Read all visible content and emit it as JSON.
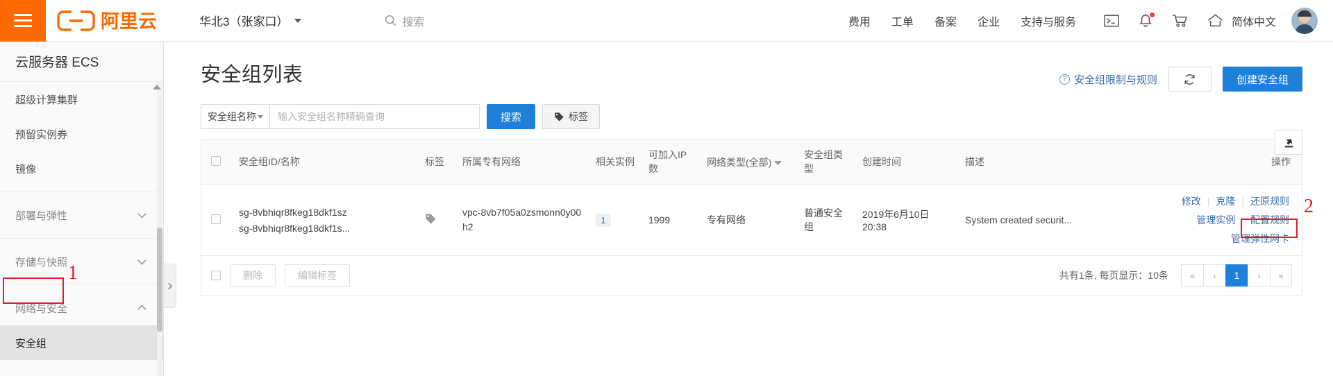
{
  "topbar": {
    "menu_icon": "hamburger-icon",
    "brand_name": "阿里云",
    "region": "华北3（张家口）",
    "search_placeholder": "搜索",
    "nav_links": [
      {
        "label": "费用"
      },
      {
        "label": "工单"
      },
      {
        "label": "备案"
      },
      {
        "label": "企业"
      },
      {
        "label": "支持与服务"
      }
    ],
    "icons": [
      {
        "name": "terminal-icon"
      },
      {
        "name": "bell-icon",
        "badge": true
      },
      {
        "name": "shopping-cart-icon"
      },
      {
        "name": "home-icon"
      }
    ],
    "language": "简体中文",
    "avatar": "user-avatar"
  },
  "sidebar": {
    "title": "云服务器 ECS",
    "items": [
      {
        "label": "超级计算集群",
        "type": "link",
        "active": false
      },
      {
        "label": "预留实例券",
        "type": "link",
        "active": false
      },
      {
        "label": "镜像",
        "type": "link",
        "active": false
      },
      {
        "label": "部署与弹性",
        "type": "group",
        "expanded": false
      },
      {
        "label": "存储与快照",
        "type": "group",
        "expanded": false
      },
      {
        "label": "网络与安全",
        "type": "group",
        "expanded": true
      },
      {
        "label": "安全组",
        "type": "link",
        "active": true
      }
    ]
  },
  "page": {
    "title": "安全组列表",
    "help_link": "安全组限制与规则",
    "refresh_icon": "refresh-icon",
    "create_button": "创建安全组",
    "export_icon": "export-icon"
  },
  "filters": {
    "select_value": "安全组名称",
    "input_value": "",
    "input_placeholder": "输入安全组名称精确查询",
    "search_button": "搜索",
    "tag_button": "标签",
    "tag_icon": "tag-icon"
  },
  "table": {
    "columns": [
      {
        "key": "checkbox",
        "label": ""
      },
      {
        "key": "id_name",
        "label": "安全组ID/名称"
      },
      {
        "key": "tag",
        "label": "标签"
      },
      {
        "key": "vpc",
        "label": "所属专有网络"
      },
      {
        "key": "instances",
        "label": "相关实例"
      },
      {
        "key": "ip_count",
        "label": "可加入IP数"
      },
      {
        "key": "net_type",
        "label": "网络类型(全部)",
        "sortable": true
      },
      {
        "key": "sg_type",
        "label": "安全组类型"
      },
      {
        "key": "created",
        "label": "创建时间"
      },
      {
        "key": "description",
        "label": "描述"
      },
      {
        "key": "operations",
        "label": "操作"
      }
    ],
    "rows": [
      {
        "id": "sg-8vbhiqr8fkeg18dkf1sz",
        "name": "sg-8vbhiqr8fkeg18dkf1s...",
        "tag_icon": "tag-icon",
        "vpc": "vpc-8vb7f05a0zsmonn0y00h2",
        "instances": "1",
        "ip_count": "1999",
        "net_type": "专有网络",
        "sg_type": "普通安全组",
        "created": "2019年6月10日 20:38",
        "description": "System created securit...",
        "operations_row1": [
          "修改",
          "克隆",
          "还原规则"
        ],
        "operations_row2": [
          "管理实例",
          "配置规则"
        ],
        "operations_row3": [
          "管理弹性网卡"
        ]
      }
    ]
  },
  "footer": {
    "delete_button": "删除",
    "edit_tag_button": "编辑标签",
    "total_text": "共有1条, 每页显示：10条",
    "pager": [
      "«",
      "‹",
      "1",
      "›",
      "»"
    ],
    "current_page": "1"
  },
  "annotations": [
    {
      "number": "1",
      "target": "sidebar-item-security-group"
    },
    {
      "number": "2",
      "target": "op-link-configure-rules"
    }
  ],
  "colors": {
    "brand_orange": "#ff6a00",
    "primary_blue": "#1e80d8",
    "link_blue": "#3d6fb0",
    "annotation_red": "#e8192c"
  }
}
